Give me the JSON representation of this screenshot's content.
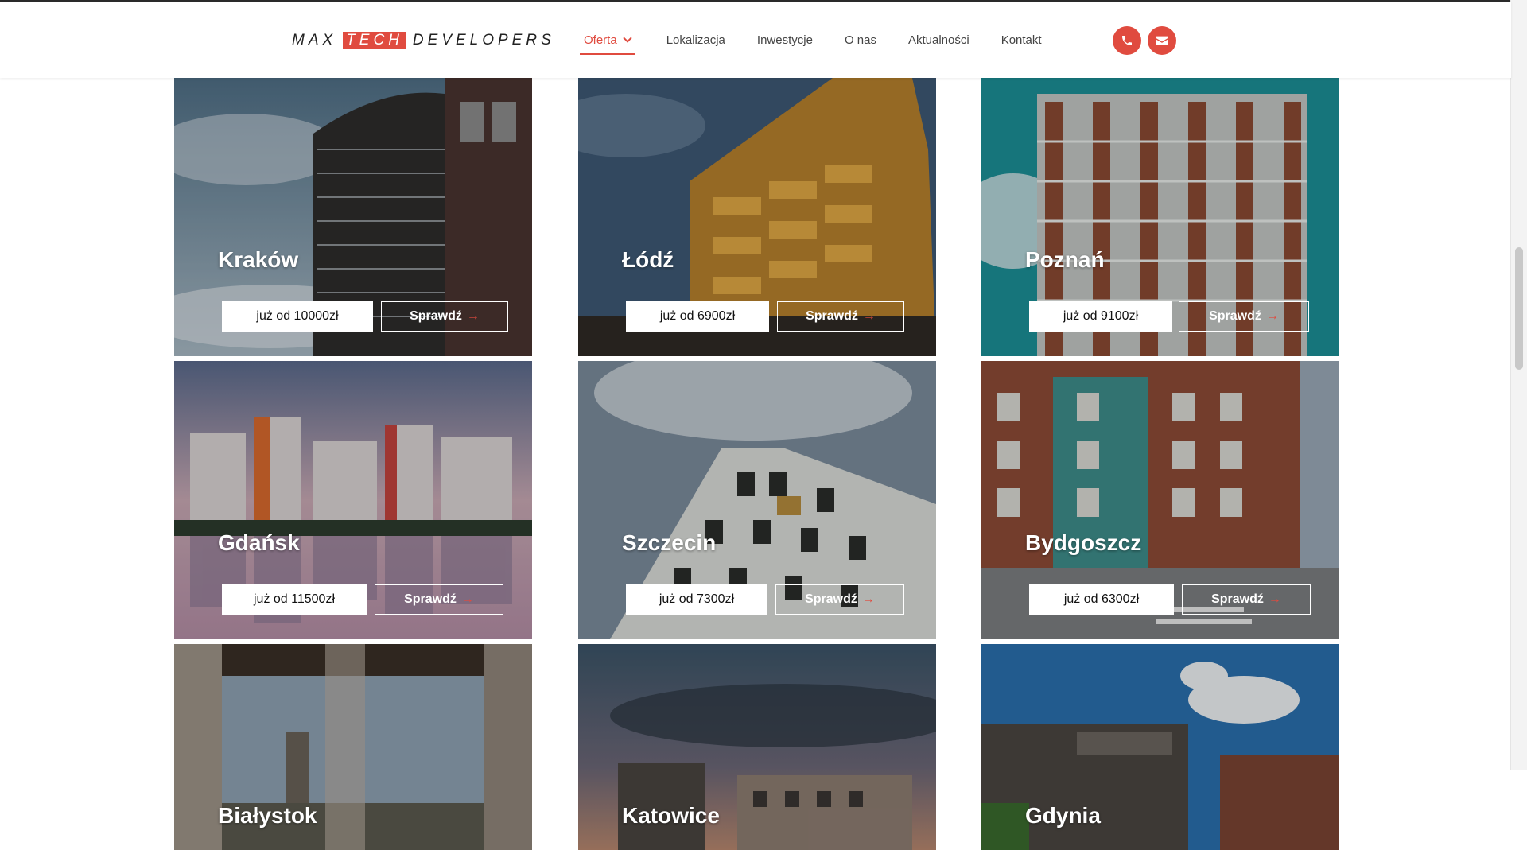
{
  "brand": {
    "part1": "MAX",
    "highlight": "TECH",
    "part2": "DEVELOPERS"
  },
  "nav": [
    {
      "label": "Oferta",
      "active": true,
      "has_dropdown": true
    },
    {
      "label": "Lokalizacja"
    },
    {
      "label": "Inwestycje"
    },
    {
      "label": "O nas"
    },
    {
      "label": "Aktualności"
    },
    {
      "label": "Kontakt"
    }
  ],
  "contact_icons": [
    "phone-icon",
    "envelope-icon"
  ],
  "accent_color": "#e04b3f",
  "cards": [
    {
      "city": "Kraków",
      "price": "już od 10000zł",
      "cta": "Sprawdź"
    },
    {
      "city": "Łódź",
      "price": "już od 6900zł",
      "cta": "Sprawdź"
    },
    {
      "city": "Poznań",
      "price": "już od 9100zł",
      "cta": "Sprawdź"
    },
    {
      "city": "Gdańsk",
      "price": "już od 11500zł",
      "cta": "Sprawdź"
    },
    {
      "city": "Szczecin",
      "price": "już od 7300zł",
      "cta": "Sprawdź"
    },
    {
      "city": "Bydgoszcz",
      "price": "już od 6300zł",
      "cta": "Sprawdź"
    },
    {
      "city": "Białystok"
    },
    {
      "city": "Katowice"
    },
    {
      "city": "Gdynia"
    }
  ]
}
